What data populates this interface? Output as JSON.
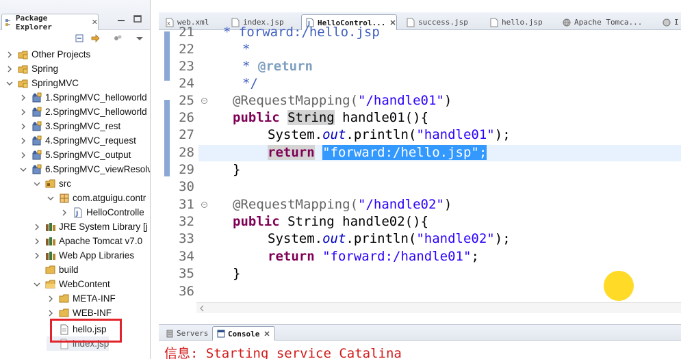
{
  "explorer": {
    "tab_label": "Package Explorer",
    "tree": [
      {
        "label": "Other Projects",
        "icon": "working-set-icon"
      },
      {
        "label": "Spring",
        "icon": "working-set-icon"
      },
      {
        "label": "SpringMVC",
        "icon": "working-set-icon"
      },
      {
        "label": "1.SpringMVC_helloworld",
        "icon": "web-project-icon"
      },
      {
        "label": "2.SpringMVC_helloworld",
        "icon": "web-project-icon"
      },
      {
        "label": "3.SpringMVC_rest",
        "icon": "web-project-icon"
      },
      {
        "label": "4.SpringMVC_request",
        "icon": "web-project-icon"
      },
      {
        "label": "5.SpringMVC_output",
        "icon": "web-project-icon"
      },
      {
        "label": "6.SpringMVC_viewResolv",
        "icon": "web-project-icon"
      },
      {
        "label": "src",
        "icon": "source-folder-icon"
      },
      {
        "label": "com.atguigu.contr",
        "icon": "package-icon"
      },
      {
        "label": "HelloControlle",
        "icon": "java-file-icon"
      },
      {
        "label": "JRE System Library [j",
        "icon": "library-icon"
      },
      {
        "label": "Apache Tomcat v7.0",
        "icon": "library-icon"
      },
      {
        "label": "Web App Libraries",
        "icon": "library-icon"
      },
      {
        "label": "build",
        "icon": "folder-icon"
      },
      {
        "label": "WebContent",
        "icon": "folder-icon"
      },
      {
        "label": "META-INF",
        "icon": "folder-icon"
      },
      {
        "label": "WEB-INF",
        "icon": "folder-icon"
      },
      {
        "label": "hello.jsp",
        "icon": "jsp-file-icon"
      },
      {
        "label": "index.jsp",
        "icon": "jsp-file-icon"
      }
    ]
  },
  "editor_tabs": [
    {
      "label": "web.xml",
      "icon": "xml-file-icon",
      "active": false
    },
    {
      "label": "index.jsp",
      "icon": "jsp-file-icon",
      "active": false
    },
    {
      "label": "HelloControl...",
      "icon": "java-file-icon",
      "active": true
    },
    {
      "label": "success.jsp",
      "icon": "jsp-file-icon",
      "active": false
    },
    {
      "label": "hello.jsp",
      "icon": "jsp-file-icon",
      "active": false
    },
    {
      "label": "Apache Tomca...",
      "icon": "browser-icon",
      "active": false
    },
    {
      "label": "I",
      "icon": "browser-icon",
      "active": false
    }
  ],
  "code": {
    "line_numbers": [
      "21",
      "22",
      "23",
      "24",
      "25",
      "26",
      "27",
      "28",
      "29",
      "30",
      "31",
      "32",
      "33",
      "34",
      "35",
      "36"
    ],
    "l21": "forward:/hello.jsp",
    "l22_star": "*",
    "l23_star": "* ",
    "l23_tag": "@return",
    "l24": "*/",
    "ann1": "@RequestMapping(",
    "ann1_str": "\"/handle01\"",
    "close_paren": ")",
    "kw_public": "public",
    "type_string": "String",
    "m1": " handle01(){",
    "sys": "System.",
    "out": "out",
    "println": ".println(",
    "p1_str": "\"handle01\"",
    "end_stmt": ");",
    "kw_return": "return",
    "ret1_str": "\"forward:/hello.jsp\"",
    "semi": ";",
    "brace": "}",
    "ann2_str": "\"/handle02\"",
    "m2": " handle02(){",
    "p2_str": "\"handle02\"",
    "ret2_str": "\"forward:/handle01\""
  },
  "console_tabs": [
    {
      "label": "Servers",
      "active": false
    },
    {
      "label": "Console",
      "active": true
    }
  ],
  "console": {
    "line": "信息: Starting service Catalina"
  },
  "colors": {
    "keyword": "#7f0055",
    "string": "#2a00ff",
    "comment": "#3f5fbf",
    "annotation": "#646464",
    "selection": "#3399ff",
    "highlight_box": "#e1242b",
    "console_text": "#d11a1a",
    "cursor_marker": "#ffd400"
  }
}
